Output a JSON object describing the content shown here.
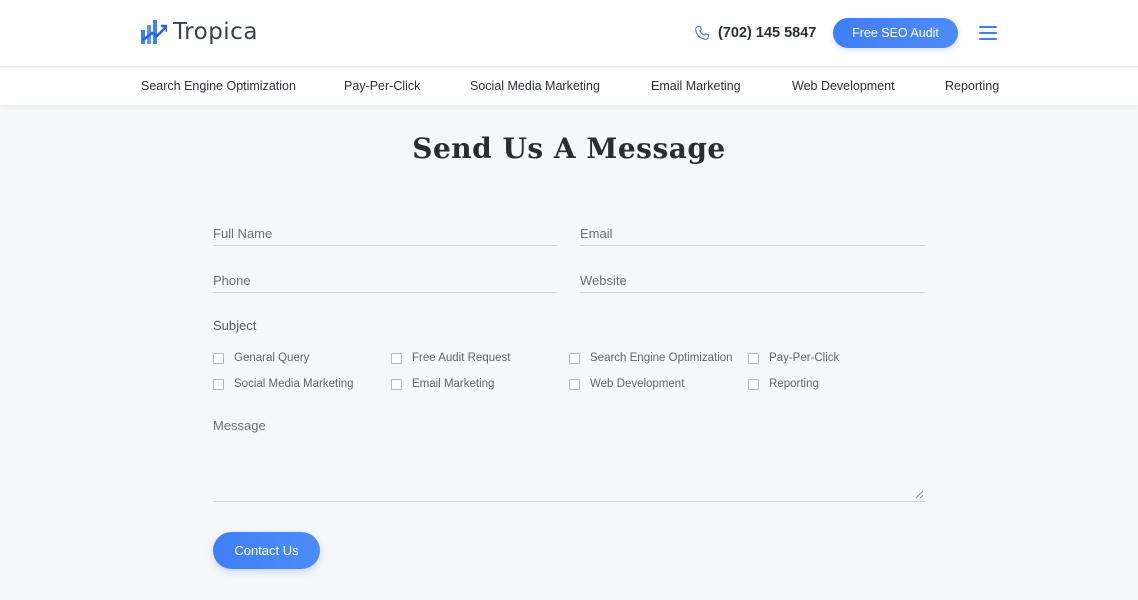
{
  "header": {
    "logo_text": "Tropica",
    "phone_number": "(702) 145 5847",
    "audit_button_label": "Free SEO Audit"
  },
  "nav": {
    "items": [
      {
        "label": "Search Engine Optimization"
      },
      {
        "label": "Pay-Per-Click"
      },
      {
        "label": "Social Media Marketing"
      },
      {
        "label": "Email Marketing"
      },
      {
        "label": "Web Development"
      },
      {
        "label": "Reporting"
      }
    ]
  },
  "form": {
    "title": "Send Us A Message",
    "full_name": {
      "placeholder": "Full Name"
    },
    "email": {
      "placeholder": "Email"
    },
    "phone": {
      "placeholder": "Phone"
    },
    "website": {
      "placeholder": "Website"
    },
    "subject_label": "Subject",
    "subjects": [
      {
        "label": "Genaral Query",
        "checked": false
      },
      {
        "label": "Free Audit Request",
        "checked": false
      },
      {
        "label": "Search Engine Optimization",
        "checked": false
      },
      {
        "label": "Pay-Per-Click",
        "checked": false
      },
      {
        "label": "Social Media Marketing",
        "checked": false
      },
      {
        "label": "Email Marketing",
        "checked": false
      },
      {
        "label": "Web Development",
        "checked": false
      },
      {
        "label": "Reporting",
        "checked": false
      }
    ],
    "message": {
      "placeholder": "Message"
    },
    "submit_label": "Contact Us"
  },
  "colors": {
    "accent": "#3f7ff5",
    "background": "#f6f7fa",
    "header_background": "#ffffff"
  },
  "icons": {
    "logo": "bar-chart-arrow-icon",
    "phone": "phone-icon",
    "menu": "hamburger-menu-icon"
  }
}
